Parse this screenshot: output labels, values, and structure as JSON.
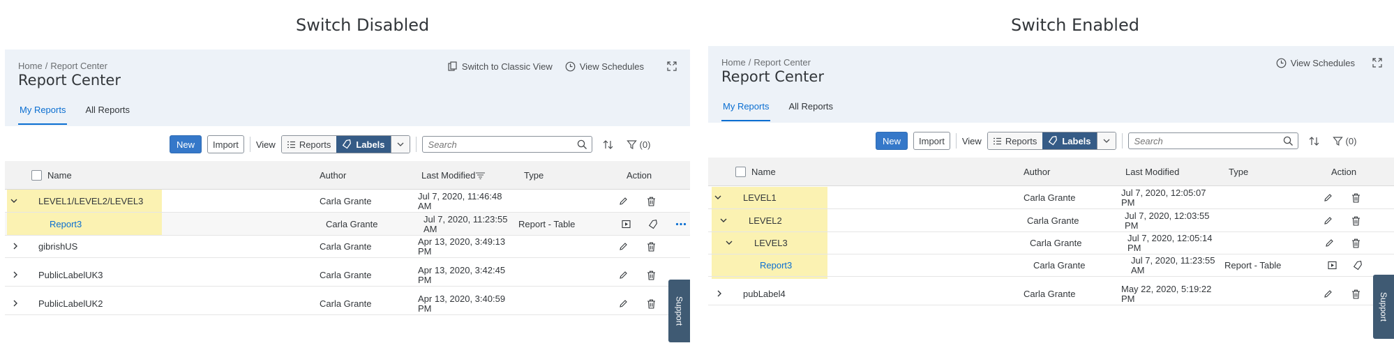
{
  "headings": {
    "left": "Switch Disabled",
    "right": "Switch Enabled"
  },
  "breadcrumb": {
    "home": "Home",
    "sep": "/",
    "current": "Report Center"
  },
  "page_title": "Report Center",
  "header_actions": {
    "classic_view": "Switch to Classic View",
    "schedules": "View Schedules"
  },
  "tabs": [
    "My Reports",
    "All Reports"
  ],
  "toolbar": {
    "new": "New",
    "import": "Import",
    "view_label": "View",
    "reports": "Reports",
    "labels": "Labels",
    "search_placeholder": "Search",
    "filter_count": "(0)"
  },
  "columns": {
    "name": "Name",
    "author": "Author",
    "last_modified": "Last Modified",
    "type": "Type",
    "action": "Action"
  },
  "left_rows": [
    {
      "name": "LEVEL1/LEVEL2/LEVEL3",
      "author": "Carla Grante",
      "mod1": "Jul 7, 2020, 11:46:48",
      "mod2": "AM",
      "type": ""
    },
    {
      "name": "Report3",
      "author": "Carla Grante",
      "mod1": "Jul 7, 2020, 11:23:55",
      "mod2": "AM",
      "type": "Report - Table"
    },
    {
      "name": "gibrishUS",
      "author": "Carla Grante",
      "mod1": "Apr 13, 2020, 3:49:13",
      "mod2": "PM",
      "type": ""
    },
    {
      "name": "PublicLabelUK3",
      "author": "Carla Grante",
      "mod1": "Apr 13, 2020, 3:42:45",
      "mod2": "PM",
      "type": ""
    },
    {
      "name": "PublicLabelUK2",
      "author": "Carla Grante",
      "mod1": "Apr 13, 2020, 3:40:59",
      "mod2": "PM",
      "type": ""
    }
  ],
  "right_rows": [
    {
      "name": "LEVEL1",
      "author": "Carla Grante",
      "mod1": "Jul 7, 2020, 12:05:07",
      "mod2": "PM",
      "type": ""
    },
    {
      "name": "LEVEL2",
      "author": "Carla Grante",
      "mod1": "Jul 7, 2020, 12:03:55",
      "mod2": "PM",
      "type": ""
    },
    {
      "name": "LEVEL3",
      "author": "Carla Grante",
      "mod1": "Jul 7, 2020, 12:05:14",
      "mod2": "PM",
      "type": ""
    },
    {
      "name": "Report3",
      "author": "Carla Grante",
      "mod1": "Jul 7, 2020, 11:23:55",
      "mod2": "AM",
      "type": "Report - Table"
    },
    {
      "name": "pubLabel4",
      "author": "Carla Grante",
      "mod1": "May 22, 2020, 5:19:22",
      "mod2": "PM",
      "type": ""
    }
  ],
  "support_label": "Support",
  "colors": {
    "accent": "#0a6ed1",
    "highlight": "#fbf2b2",
    "header_bg": "#edf2f8",
    "support": "#3f5a73"
  }
}
